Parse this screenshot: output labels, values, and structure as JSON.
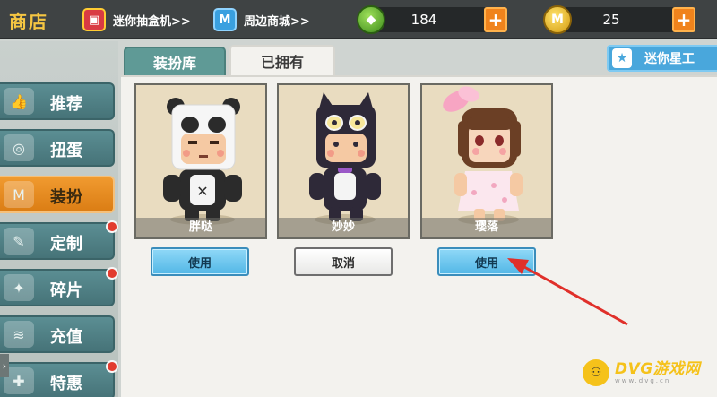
{
  "topbar": {
    "title": "商店",
    "link_box": "迷你抽盒机>>",
    "link_mall": "周边商城>>",
    "gems": "184",
    "coins": "25",
    "plus": "+"
  },
  "tabs": {
    "wardrobe": "装扮库",
    "owned": "已拥有",
    "star": "迷你星工"
  },
  "sidebar": {
    "items": [
      {
        "label": "推荐",
        "icon": "thumbs-up-icon",
        "active": false,
        "badge": false
      },
      {
        "label": "扭蛋",
        "icon": "capsule-icon",
        "active": false,
        "badge": false
      },
      {
        "label": "装扮",
        "icon": "shirt-icon",
        "active": true,
        "badge": false
      },
      {
        "label": "定制",
        "icon": "brush-icon",
        "active": false,
        "badge": true
      },
      {
        "label": "碎片",
        "icon": "puzzle-icon",
        "active": false,
        "badge": true
      },
      {
        "label": "充值",
        "icon": "coins-icon",
        "active": false,
        "badge": false
      },
      {
        "label": "特惠",
        "icon": "gift-icon",
        "active": false,
        "badge": true
      }
    ]
  },
  "cards": [
    {
      "name": "胖哒",
      "button": "使用",
      "button_kind": "use"
    },
    {
      "name": "妙妙",
      "button": "取消",
      "button_kind": "cancel"
    },
    {
      "name": "璎落",
      "button": "使用",
      "button_kind": "use"
    }
  ],
  "watermark": {
    "main": "DVG游戏网",
    "sub": "www.dvg.cn"
  },
  "colors": {
    "accent_orange": "#f0831c",
    "use_button_blue": "#52b7e6",
    "sidebar_teal": "#467378",
    "active_tab_orange": "#db7d14",
    "arrow_red": "#e0302a"
  }
}
